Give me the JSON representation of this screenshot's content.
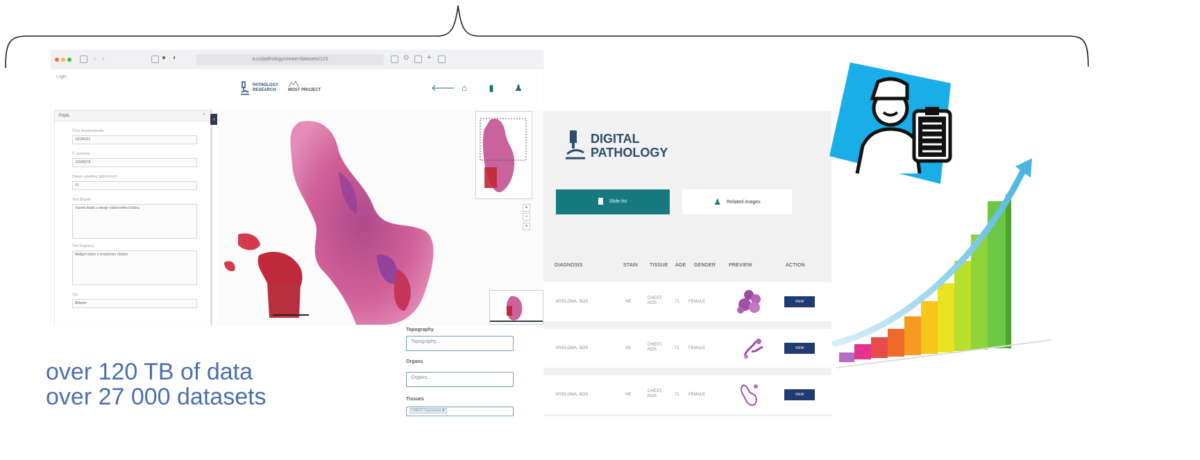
{
  "viewer": {
    "url": "a.cz/pathology/viewer/datasets/123",
    "login_label": "Login",
    "logo_line1": "PATHOLOGY",
    "logo_line2": "RESEARCH",
    "logo_line3": "MOST PROJECT",
    "panel_title": "Popis",
    "fields": [
      {
        "label": "Číslo řezu/preparátu",
        "value": "12/345/21"
      },
      {
        "label": "Č. pacienta",
        "value": "12345678"
      },
      {
        "label": "Datum vyšetření (dd/mm/rrrr)",
        "value": "01"
      },
      {
        "label": "Text Biopsie",
        "value": "Vzorek tkáně z okraje nádorového ložiska"
      },
      {
        "label": "Text Diagnózy",
        "value": "Maligní nádor s invazivním růstem"
      },
      {
        "label": "Typ",
        "value": "Biopsie"
      }
    ]
  },
  "stats": {
    "line1": "over 120 TB of data",
    "line2": "over 27 000 datasets"
  },
  "filters": {
    "topography_label": "Topography",
    "topography_placeholder": "Topography...",
    "organs_label": "Organs",
    "organs_placeholder": "Organs...",
    "tissues_label": "Tissues",
    "tissues_value": "CHEST Carcinoma ✖"
  },
  "pathology": {
    "logo_line1": "DIGITAL",
    "logo_line2": "PATHOLOGY",
    "slide_list_label": "Slide list",
    "related_label": "Related images",
    "headers": [
      "DIAGNOSIS",
      "STAIN",
      "TISSUE",
      "AGE",
      "GENDER",
      "PREVIEW",
      "ACTION"
    ],
    "rows": [
      {
        "diagnosis": "MYELOMA, NOS",
        "stain": "HE",
        "tissue": "CHEST, NOS",
        "age": "71",
        "gender": "FEMALE",
        "action": "VIEW"
      },
      {
        "diagnosis": "MYELOMA, NOS",
        "stain": "HE",
        "tissue": "CHEST, NOS",
        "age": "71",
        "gender": "FEMALE",
        "action": "VIEW"
      },
      {
        "diagnosis": "MYELOMA, NOS",
        "stain": "HE",
        "tissue": "CHEST, NOS",
        "age": "71",
        "gender": "FEMALE",
        "action": "VIEW"
      }
    ]
  },
  "colors": {
    "teal": "#177a80",
    "navy": "#1e3b72",
    "stat_text": "#4a6fb0",
    "illustration_bg": "#1aaee8"
  }
}
